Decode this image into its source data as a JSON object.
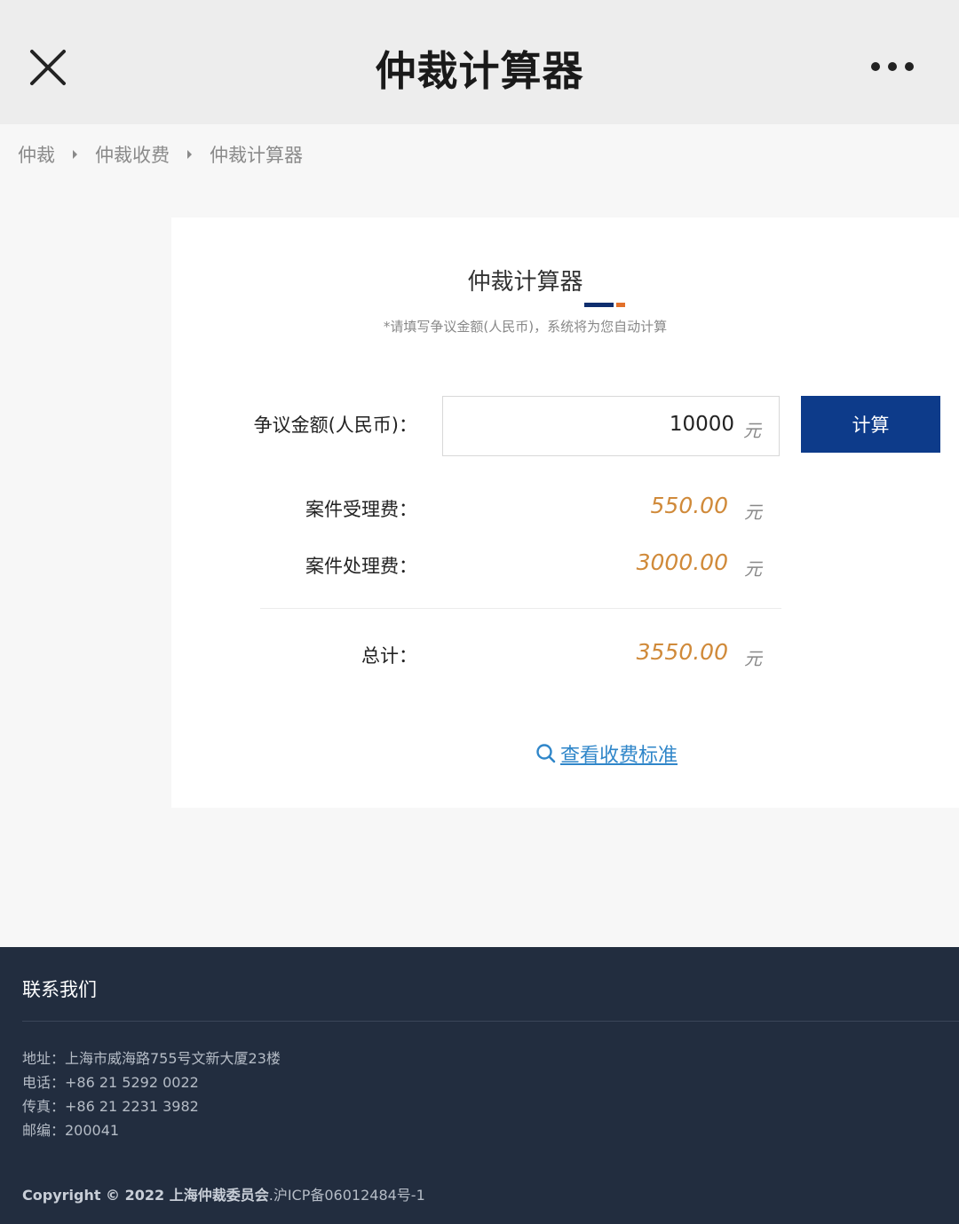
{
  "nav": {
    "title": "仲裁计算器",
    "close_icon": "close-icon",
    "more_icon": "more-icon"
  },
  "breadcrumb": {
    "items": [
      "仲裁",
      "仲裁收费",
      "仲裁计算器"
    ]
  },
  "calculator": {
    "title": "仲裁计算器",
    "hint": "*请填写争议金额(人民币)，系统将为您自动计算",
    "amount_label": "争议金额(人民币)：",
    "amount_value": "10000",
    "unit": "元",
    "calculate_button": "计算",
    "acceptance_fee_label": "案件受理费：",
    "acceptance_fee_value": "550.00",
    "processing_fee_label": "案件处理费：",
    "processing_fee_value": "3000.00",
    "total_label": "总计：",
    "total_value": "3550.00",
    "fee_standard_link": "查看收费标准"
  },
  "colors": {
    "nav_bg": "#ededed",
    "button_blue": "#0d3b8a",
    "accent_orange": "#e2702a",
    "result_orange": "#d08a3a",
    "link_blue": "#2f86c9",
    "footer_bg": "#222d3f"
  },
  "footer": {
    "title": "联系我们",
    "address": "地址：上海市威海路755号文新大厦23楼",
    "phone": "电话：+86 21 5292 0022",
    "fax": "传真：+86 21 2231 3982",
    "postcode": "邮编：200041",
    "copyright_bold": "Copyright © 2022 上海仲裁委员会",
    "copyright_rest": ".沪ICP备06012484号-1"
  }
}
